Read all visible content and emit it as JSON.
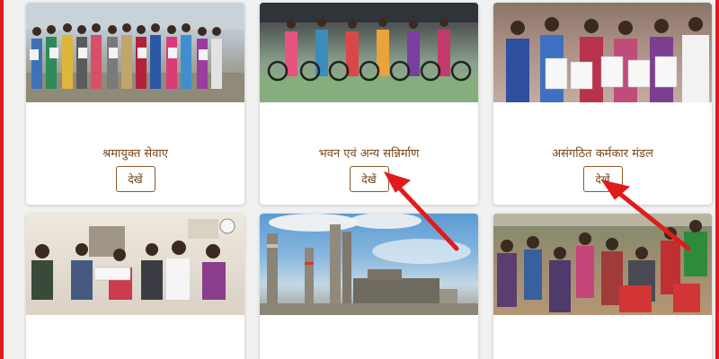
{
  "cards": [
    {
      "title": "श्रमायुक्त सेवाए",
      "button": "देखें",
      "image": "photo-women-holding-certificates"
    },
    {
      "title": "भवन एवं अन्य सन्निर्माण",
      "button": "देखें",
      "image": "photo-women-with-bicycles"
    },
    {
      "title": "असंगठित कर्मकार मंडल",
      "button": "देखें",
      "image": "photo-women-holding-documents"
    },
    {
      "title": "",
      "button": "",
      "image": "photo-office-certificate-handover"
    },
    {
      "title": "",
      "button": "",
      "image": "photo-industrial-chimneys"
    },
    {
      "title": "",
      "button": "",
      "image": "photo-outdoor-gathering"
    }
  ],
  "annotations": {
    "arrow_color": "#e11b1b"
  }
}
